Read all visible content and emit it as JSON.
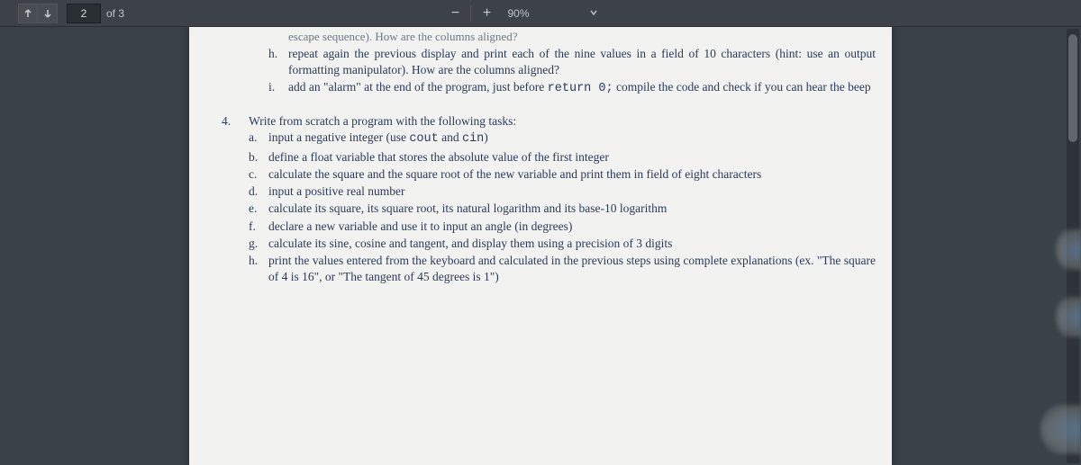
{
  "toolbar": {
    "page_current": "2",
    "page_of": "of 3",
    "zoom": "90%"
  },
  "doc": {
    "cutoff": "escape sequence). How are the columns aligned?",
    "top_items": [
      {
        "marker": "h.",
        "text": "repeat again the previous display and print each of the nine values in a field of 10 characters (hint: use an output formatting manipulator). How are the columns aligned?"
      },
      {
        "marker": "i.",
        "text_before": "add an \"alarm\" at the end of the program, just before ",
        "code": "return 0;",
        "text_after": " compile the code and check if you can hear the beep"
      }
    ],
    "section4": {
      "num": "4.",
      "head": "Write from scratch a program with the following tasks:",
      "items": [
        {
          "marker": "a.",
          "text_before": "input a negative integer (use ",
          "code1": "cout",
          "mid": " and ",
          "code2": "cin",
          "text_after": ")"
        },
        {
          "marker": "b.",
          "text": "define a float variable that stores the absolute value of the first integer"
        },
        {
          "marker": "c.",
          "text": "calculate the square and the square root of the new variable and print them in field of eight characters"
        },
        {
          "marker": "d.",
          "text": "input a positive real number"
        },
        {
          "marker": "e.",
          "text": "calculate its square, its square root, its natural logarithm and its base-10 logarithm"
        },
        {
          "marker": "f.",
          "text": "declare a new variable and use it to input an angle (in degrees)"
        },
        {
          "marker": "g.",
          "text": "calculate its sine, cosine and tangent, and display them using a precision of 3 digits"
        },
        {
          "marker": "h.",
          "text": "print the values entered from the keyboard and calculated in the previous steps using complete explanations (ex. \"The square of 4 is 16\", or \"The tangent of 45 degrees is 1\")"
        }
      ]
    }
  }
}
